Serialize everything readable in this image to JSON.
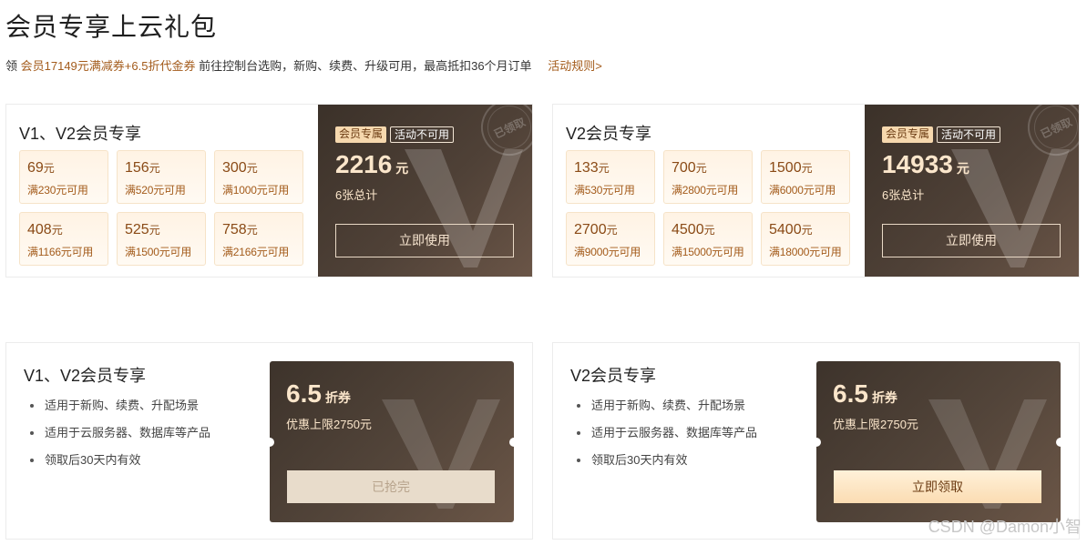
{
  "page": {
    "title": "会员专享上云礼包",
    "subline": {
      "prefix": "领",
      "highlight": "会员17149元满减券+6.5折代金券",
      "rest": "前往控制台选购，新购、续费、升级可用，最高抵扣36个月订单",
      "rules_link": "活动规则>"
    }
  },
  "top_cards": [
    {
      "title": "V1、V2会员专享",
      "coupons": [
        {
          "amount": "69",
          "unit": "元",
          "condition": "满230元可用"
        },
        {
          "amount": "156",
          "unit": "元",
          "condition": "满520元可用"
        },
        {
          "amount": "300",
          "unit": "元",
          "condition": "满1000元可用"
        },
        {
          "amount": "408",
          "unit": "元",
          "condition": "满1166元可用"
        },
        {
          "amount": "525",
          "unit": "元",
          "condition": "满1500元可用"
        },
        {
          "amount": "758",
          "unit": "元",
          "condition": "满2166元可用"
        }
      ],
      "badge_member": "会员专属",
      "badge_status": "活动不可用",
      "stamp": "已领取",
      "total": "2216",
      "total_unit": "元",
      "count": "6张总计",
      "button": "立即使用"
    },
    {
      "title": "V2会员专享",
      "coupons": [
        {
          "amount": "133",
          "unit": "元",
          "condition": "满530元可用"
        },
        {
          "amount": "700",
          "unit": "元",
          "condition": "满2800元可用"
        },
        {
          "amount": "1500",
          "unit": "元",
          "condition": "满6000元可用"
        },
        {
          "amount": "2700",
          "unit": "元",
          "condition": "满9000元可用"
        },
        {
          "amount": "4500",
          "unit": "元",
          "condition": "满15000元可用"
        },
        {
          "amount": "5400",
          "unit": "元",
          "condition": "满18000元可用"
        }
      ],
      "badge_member": "会员专属",
      "badge_status": "活动不可用",
      "stamp": "已领取",
      "total": "14933",
      "total_unit": "元",
      "count": "6张总计",
      "button": "立即使用"
    }
  ],
  "bottom_cards": [
    {
      "title": "V1、V2会员专享",
      "bullets": [
        "适用于新购、续费、升配场景",
        "适用于云服务器、数据库等产品",
        "领取后30天内有效"
      ],
      "discount": "6.5",
      "discount_unit": "折券",
      "cap": "优惠上限2750元",
      "button": "已抢完"
    },
    {
      "title": "V2会员专享",
      "bullets": [
        "适用于新购、续费、升配场景",
        "适用于云服务器、数据库等产品",
        "领取后30天内有效"
      ],
      "discount": "6.5",
      "discount_unit": "折券",
      "cap": "优惠上限2750元",
      "button": "立即领取"
    }
  ],
  "watermark": "CSDN @Damon小智",
  "colors": {
    "accent": "#a35b1b",
    "panel_dark": "#3b3129",
    "gold_text": "#fbe6cb"
  }
}
